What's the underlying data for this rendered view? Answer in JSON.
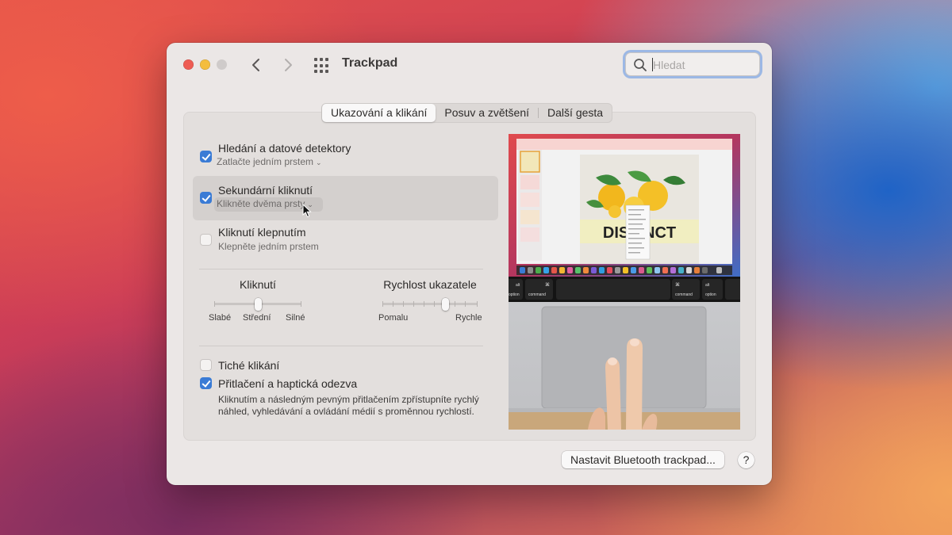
{
  "window": {
    "title": "Trackpad",
    "search": {
      "placeholder": "Hledat",
      "value": ""
    }
  },
  "tabs": [
    {
      "label": "Ukazování a klikání",
      "active": true
    },
    {
      "label": "Posuv a zvětšení",
      "active": false
    },
    {
      "label": "Další gesta",
      "active": false
    }
  ],
  "options": {
    "lookup": {
      "label": "Hledání a datové detektory",
      "sub": "Zatlačte jedním prstem",
      "checked": true
    },
    "secondary_click": {
      "label": "Sekundární kliknutí",
      "sub": "Klikněte dvěma prsty",
      "checked": true
    },
    "tap_to_click": {
      "label": "Kliknutí klepnutím",
      "sub": "Klepněte jedním prstem",
      "checked": false
    },
    "silent_click": {
      "label": "Tiché klikání",
      "checked": false
    },
    "force_click": {
      "label": "Přitlačení a haptická odezva",
      "checked": true,
      "description": "Kliknutím a následným pevným přitlačením zpřístupníte rychlý náhled, vyhledávání a ovládání médií s proměnnou rychlostí."
    }
  },
  "sliders": {
    "click": {
      "title": "Kliknutí",
      "min_label": "Slabé",
      "mid_label": "Střední",
      "max_label": "Silné",
      "level": 0.5
    },
    "tracking_speed": {
      "title": "Rychlost ukazatele",
      "min_label": "Pomalu",
      "max_label": "Rychle",
      "level": 0.67
    }
  },
  "preview": {
    "slide_title": "DISTINCT",
    "keys": {
      "left_option": "option",
      "left_command": "command",
      "right_command": "command",
      "right_option": "option",
      "alt_left": "alt",
      "alt_right": "alt",
      "cmd_symbol": "⌘"
    }
  },
  "buttons": {
    "bluetooth": "Nastavit Bluetooth trackpad...",
    "help": "?"
  },
  "colors": {
    "accent": "#3a7bd5",
    "window_bg": "#ebe7e6",
    "close": "#ee5c53",
    "minimize": "#f4bd3e"
  }
}
